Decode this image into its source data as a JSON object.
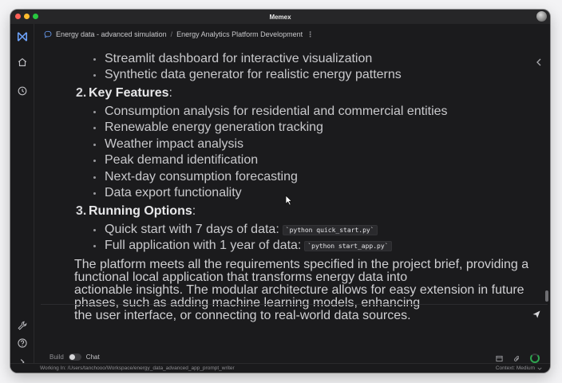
{
  "window": {
    "title": "Memex"
  },
  "colors": {
    "accent": "#4c8cf5",
    "traffic_red": "#ff5f57",
    "traffic_yellow": "#febc2e",
    "traffic_green": "#28c840",
    "context_ring": "#2ea44f"
  },
  "sidebar": {
    "logo_icon": "memex-logo-icon",
    "items": [
      {
        "icon": "home-icon"
      },
      {
        "icon": "history-icon"
      }
    ],
    "bottom": [
      {
        "icon": "wrench-icon"
      },
      {
        "icon": "help-icon"
      },
      {
        "icon": "chevron-right-icon"
      }
    ]
  },
  "breadcrumb": {
    "project": "Energy data - advanced simulation",
    "separator": "/",
    "conversation": "Energy Analytics Platform Development",
    "more": "⋮"
  },
  "message": {
    "top_bullets": [
      "Streamlit dashboard for interactive visualization",
      "Synthetic data generator for realistic energy patterns"
    ],
    "sections": [
      {
        "number": "2.",
        "title": "Key Features",
        "suffix": ":",
        "bullets": [
          "Consumption analysis for residential and commercial entities",
          "Renewable energy generation tracking",
          "Weather impact analysis",
          "Peak demand identification",
          "Next-day consumption forecasting",
          "Data export functionality"
        ]
      },
      {
        "number": "3.",
        "title": "Running Options",
        "suffix": ":",
        "bullets": [
          {
            "text": "Quick start with 7 days of data:",
            "code": "`python quick_start.py`"
          },
          {
            "text": "Full application with 1 year of data:",
            "code": "`python start_app.py`"
          }
        ]
      }
    ],
    "summary_lines": [
      "The platform meets all the requirements specified in the project brief, providing a functional local application that transforms energy data into",
      "actionable insights. The modular architecture allows for easy extension in future phases, such as adding machine learning models, enhancing",
      "the user interface, or connecting to real-world data sources."
    ]
  },
  "composer": {
    "placeholder": "",
    "mode_left": "Build",
    "mode_right": "Chat",
    "send_icon": "send-icon"
  },
  "statusbar": {
    "working_in_label": "Working In:",
    "working_in_path": "/Users/tanchooo/Workspace/energy_data_advanced_app_prompt_writer",
    "context_label": "Context: Medium"
  }
}
